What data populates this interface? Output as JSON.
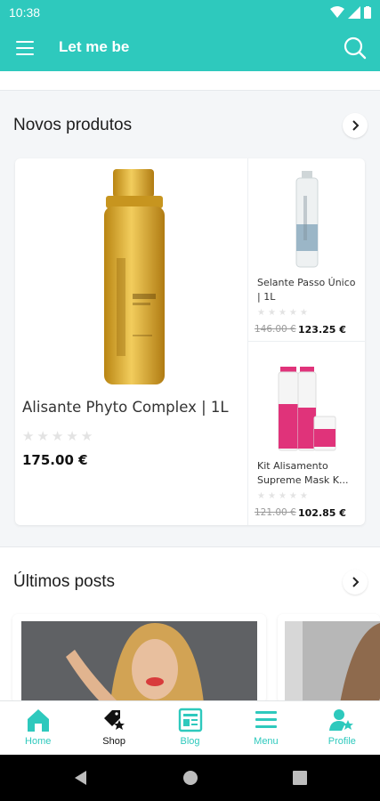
{
  "status_bar": {
    "time": "10:38"
  },
  "app_bar": {
    "title": "Let me be",
    "menu_icon": "hamburger-icon",
    "search_icon": "search-icon"
  },
  "colors": {
    "brand": "#2ec9bd",
    "gold": "#d4a52c",
    "pink": "#e0337a"
  },
  "sections": {
    "new_products": {
      "title": "Novos produtos",
      "arrow_icon": "chevron-right-icon"
    },
    "latest_posts": {
      "title": "Últimos posts",
      "arrow_icon": "chevron-right-icon"
    }
  },
  "products": [
    {
      "name": "Alisante Phyto Complex | 1L",
      "price": "175.00 €",
      "rating": 0
    },
    {
      "name": "Selante Passo Único | 1L",
      "old_price": "146.00 €",
      "price": "123.25 €",
      "rating": 0
    },
    {
      "name": "Kit Alisamento Supreme Mask K...",
      "old_price": "121.00 €",
      "price": "102.85 €",
      "rating": 0
    }
  ],
  "bottom_nav": [
    {
      "label": "Home",
      "icon": "home-icon"
    },
    {
      "label": "Shop",
      "icon": "shop-star-icon"
    },
    {
      "label": "Blog",
      "icon": "blog-icon"
    },
    {
      "label": "Menu",
      "icon": "menu-icon"
    },
    {
      "label": "Profile",
      "icon": "profile-star-icon"
    }
  ]
}
